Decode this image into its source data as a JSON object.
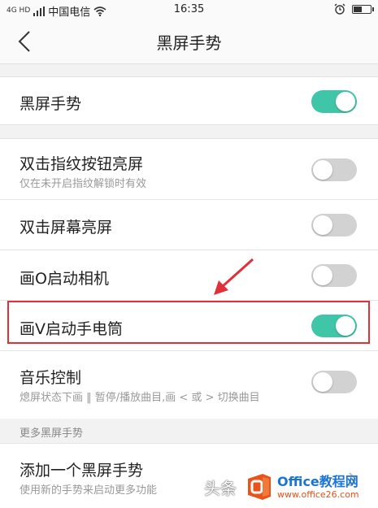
{
  "status_bar": {
    "signal_label": "4G HD",
    "carrier": "中国电信",
    "time": "16:35",
    "battery_level_percent": 55
  },
  "header": {
    "title": "黑屏手势"
  },
  "rows": [
    {
      "label": "黑屏手势",
      "sub": "",
      "on": true
    },
    {
      "label": "双击指纹按钮亮屏",
      "sub": "仅在未开启指纹解锁时有效",
      "on": false
    },
    {
      "label": "双击屏幕亮屏",
      "sub": "",
      "on": false
    },
    {
      "label": "画O启动相机",
      "sub": "",
      "on": false
    },
    {
      "label": "画V启动手电筒",
      "sub": "",
      "on": true
    },
    {
      "label": "音乐控制",
      "sub": "熄屏状态下画 ‖ 暂停/播放曲目,画 < 或 > 切换曲目",
      "on": false
    }
  ],
  "section": {
    "title": "更多黑屏手势"
  },
  "add_gesture": {
    "label": "添加一个黑屏手势",
    "sub": "使用新的手势来启动更多功能"
  },
  "watermark": {
    "left_text": "头条",
    "brand": "Office教程网",
    "url": "www.office26.com"
  },
  "colors": {
    "toggle_on": "#3fc6a8",
    "toggle_off": "#d2d2d2",
    "highlight": "#e0303a"
  }
}
